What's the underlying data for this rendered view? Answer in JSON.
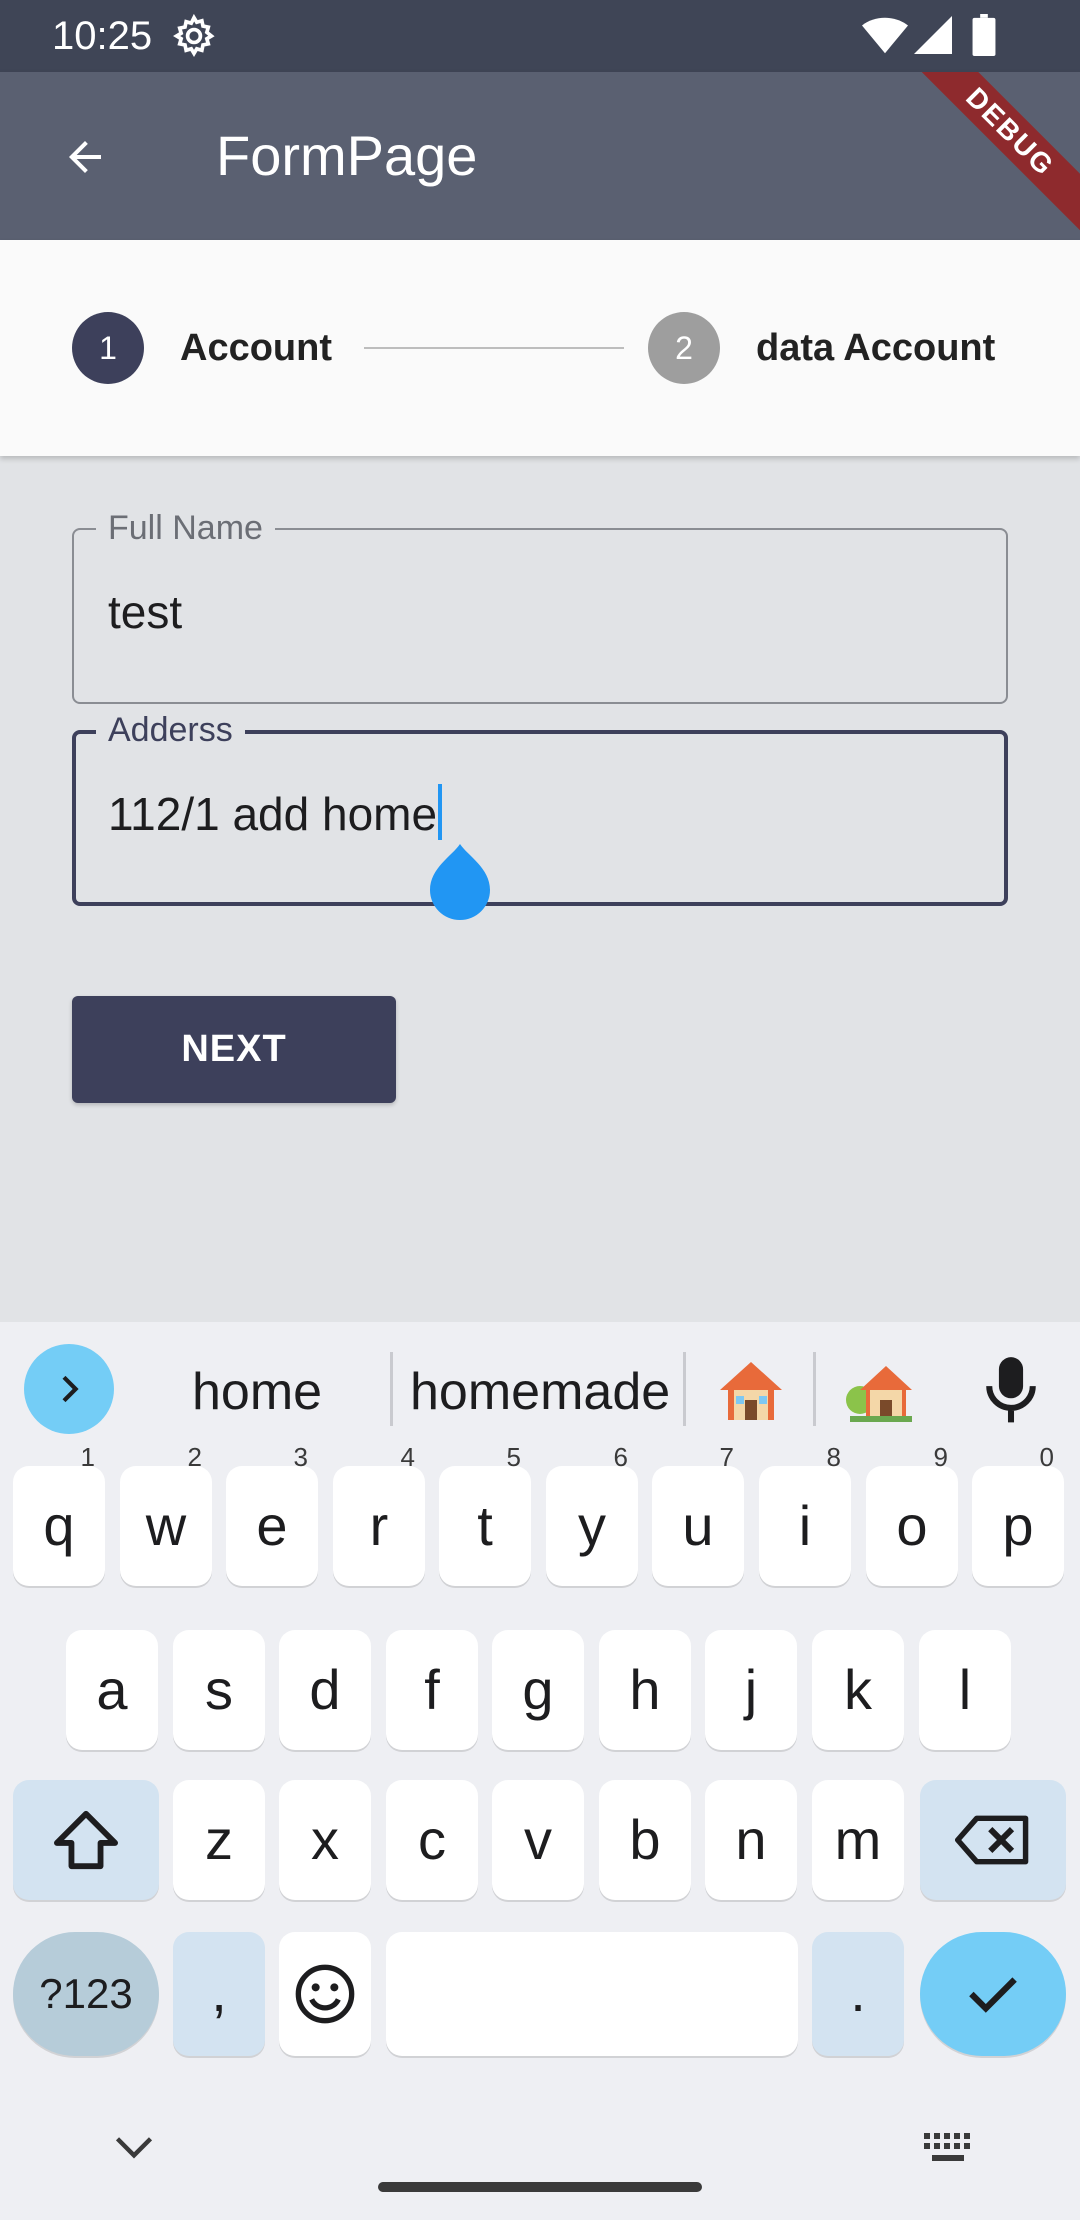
{
  "status_bar": {
    "time": "10:25"
  },
  "app_bar": {
    "title": "FormPage",
    "debug_banner": "DEBUG"
  },
  "stepper": {
    "steps": [
      {
        "number": "1",
        "label": "Account"
      },
      {
        "number": "2",
        "label": "data Account"
      }
    ]
  },
  "form": {
    "full_name": {
      "label": "Full Name",
      "value": "test"
    },
    "address": {
      "label": "Adderss",
      "value": "112/1 add home"
    },
    "next_label": "NEXT"
  },
  "keyboard": {
    "suggestions": [
      "home",
      "homemade"
    ],
    "emoji_suggestions": [
      "house-emoji",
      "house-with-garden-emoji"
    ],
    "row1": [
      {
        "key": "q",
        "hint": "1"
      },
      {
        "key": "w",
        "hint": "2"
      },
      {
        "key": "e",
        "hint": "3"
      },
      {
        "key": "r",
        "hint": "4"
      },
      {
        "key": "t",
        "hint": "5"
      },
      {
        "key": "y",
        "hint": "6"
      },
      {
        "key": "u",
        "hint": "7"
      },
      {
        "key": "i",
        "hint": "8"
      },
      {
        "key": "o",
        "hint": "9"
      },
      {
        "key": "p",
        "hint": "0"
      }
    ],
    "row2": [
      "a",
      "s",
      "d",
      "f",
      "g",
      "h",
      "j",
      "k",
      "l"
    ],
    "row3": [
      "z",
      "x",
      "c",
      "v",
      "b",
      "n",
      "m"
    ],
    "symbols_label": "?123",
    "comma_label": ",",
    "period_label": "."
  },
  "colors": {
    "status_bar": "#3f4556",
    "app_bar": "#5a6071",
    "primary": "#3d405b",
    "cursor": "#2196f3",
    "keyboard_accent": "#74cdf6"
  }
}
